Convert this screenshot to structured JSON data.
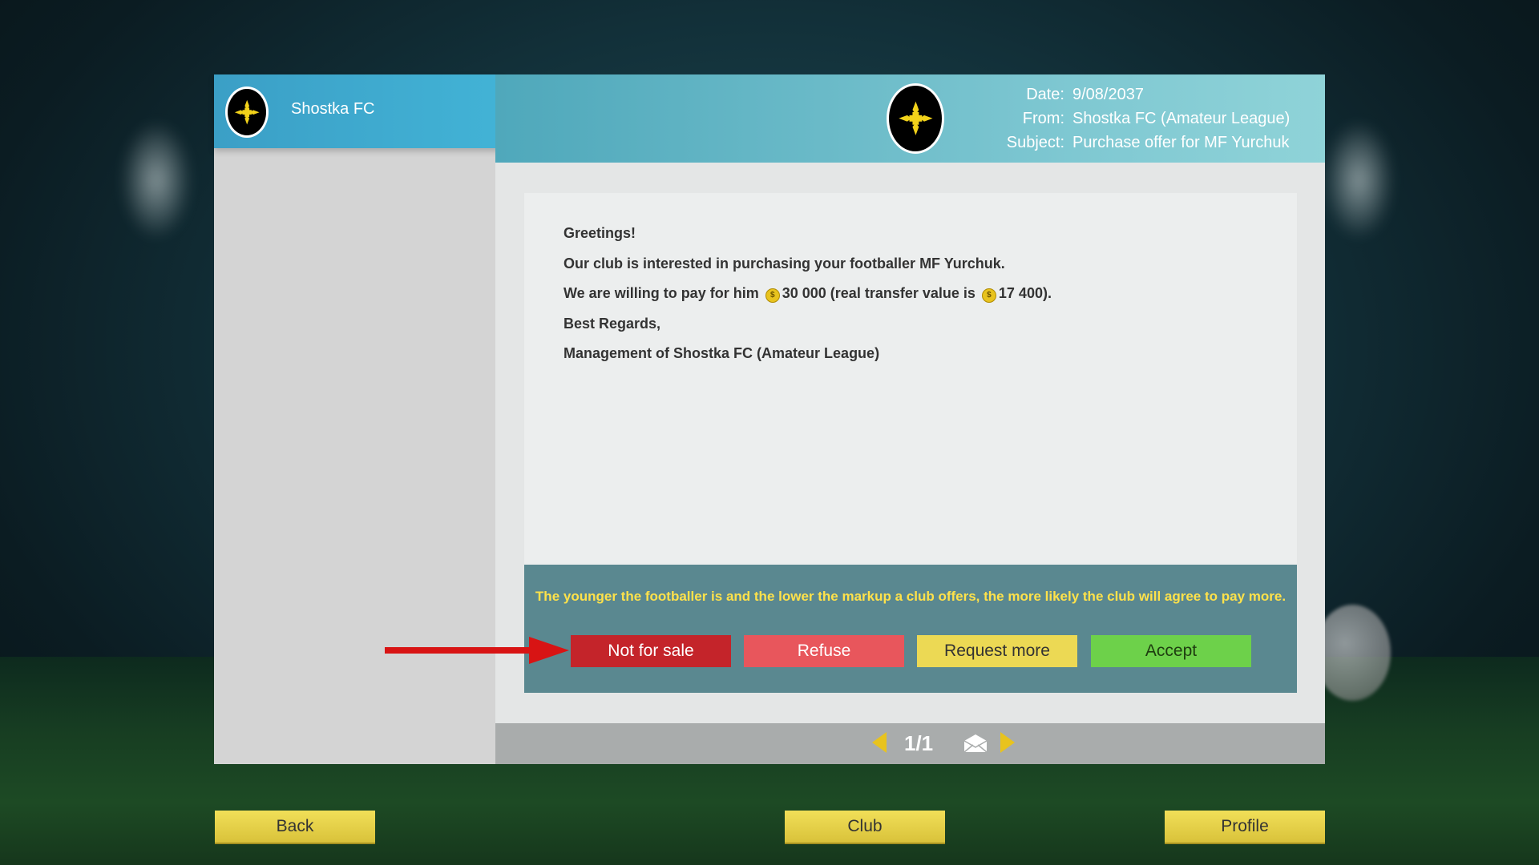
{
  "sidebar": {
    "club_name": "Shostka FC",
    "badge_icon": "club-crest-icon"
  },
  "message": {
    "date_label": "Date:",
    "date": "9/08/2037",
    "from_label": "From:",
    "from": "Shostka FC (Amateur League)",
    "subject_label": "Subject:",
    "subject": "Purchase offer for MF Yurchuk",
    "greeting": "Greetings!",
    "line1": "Our club is interested in purchasing your footballer MF Yurchuk.",
    "line2_prefix": "We are willing to pay for him",
    "offer_amount": "30 000",
    "line2_middle": "(real transfer value is",
    "transfer_value": "17 400",
    "line2_suffix": ").",
    "closing": "Best Regards,",
    "signature": "Management of Shostka FC (Amateur League)"
  },
  "actions": {
    "hint": "The younger the footballer is and the lower the markup a club offers, the more likely the club will agree to pay more.",
    "not_for_sale": "Not for sale",
    "refuse": "Refuse",
    "request_more": "Request more",
    "accept": "Accept"
  },
  "pager": {
    "text": "1/1"
  },
  "nav": {
    "back": "Back",
    "club": "Club",
    "profile": "Profile"
  },
  "colors": {
    "header_gradient_start": "#4fa8bb",
    "not_for_sale": "#c4242a",
    "refuse": "#e8565c",
    "request_more": "#ecd954",
    "accept": "#6dd14a",
    "hint_text": "#ffe24a",
    "nav_button": "#e8d24a"
  }
}
